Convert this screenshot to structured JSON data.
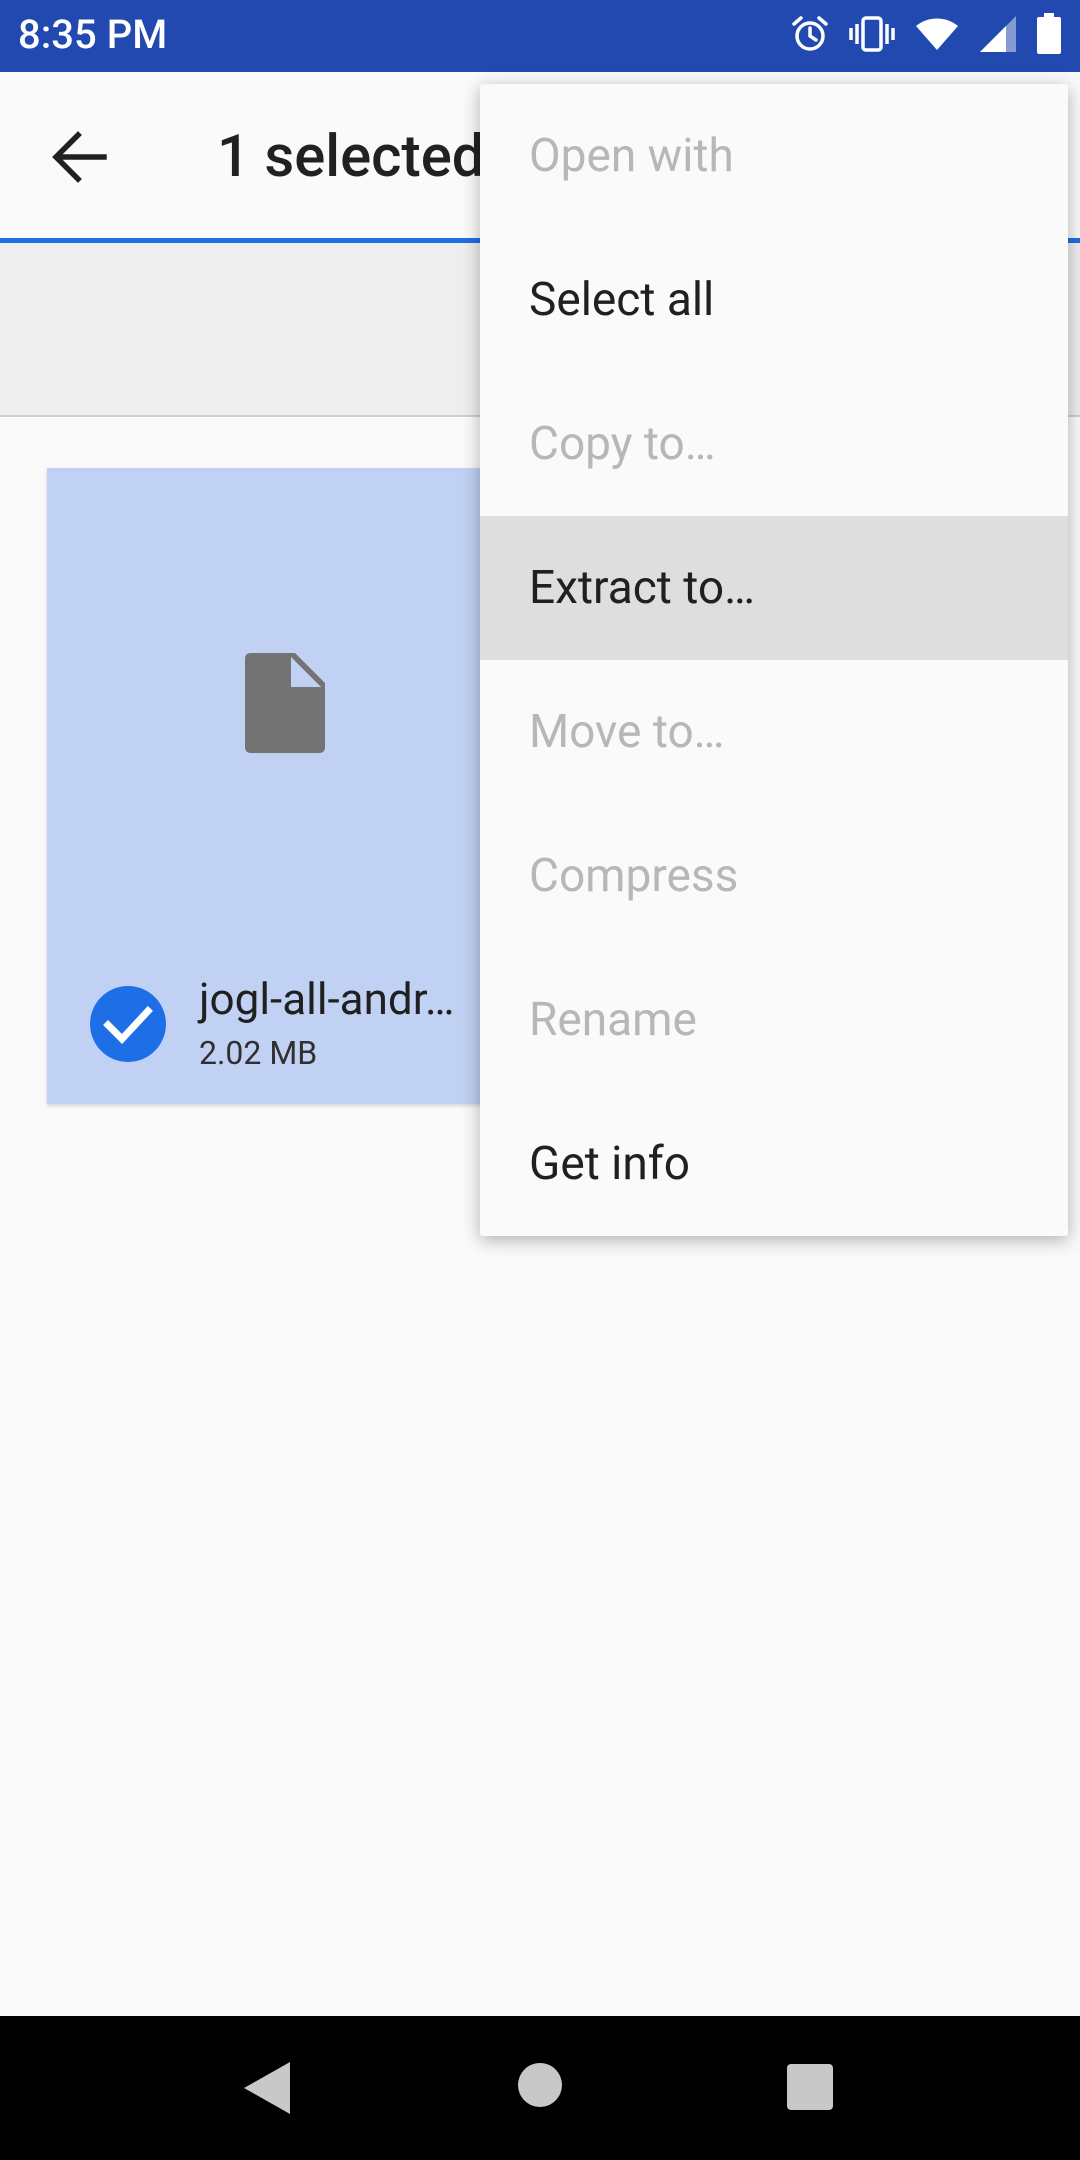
{
  "status_bar": {
    "time": "8:35 PM",
    "icons": [
      "alarm-icon",
      "vibrate-icon",
      "wifi-icon",
      "cellular-signal-icon",
      "battery-icon"
    ]
  },
  "app_bar": {
    "title": "1 selected",
    "back_icon": "arrow-back-icon",
    "accent_color": "#1e6fe5"
  },
  "file": {
    "name": "jogl-all-andr…",
    "size": "2.02 MB",
    "selected": true,
    "icon": "file-icon"
  },
  "menu": {
    "items": [
      {
        "label": "Open with",
        "enabled": false
      },
      {
        "label": "Select all",
        "enabled": true
      },
      {
        "label": "Copy to…",
        "enabled": false
      },
      {
        "label": "Extract to…",
        "enabled": true,
        "highlighted": true
      },
      {
        "label": "Move to…",
        "enabled": false
      },
      {
        "label": "Compress",
        "enabled": false
      },
      {
        "label": "Rename",
        "enabled": false
      },
      {
        "label": "Get info",
        "enabled": true
      }
    ]
  },
  "nav_bar": {
    "buttons": [
      "nav-back-icon",
      "nav-home-icon",
      "nav-recents-icon"
    ]
  },
  "colors": {
    "status_bar": "#2149b0",
    "selection_tile": "#c1d1f3",
    "check": "#1e6fe5",
    "menu_highlight": "#dedede"
  }
}
